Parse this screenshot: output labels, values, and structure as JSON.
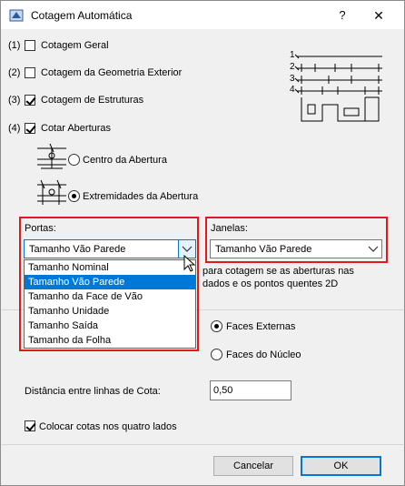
{
  "window": {
    "title": "Cotagem Automática",
    "help_label": "?",
    "close_label": "✕"
  },
  "options": [
    {
      "num": "(1)",
      "label": "Cotagem Geral",
      "checked": false
    },
    {
      "num": "(2)",
      "label": "Cotagem da Geometria Exterior",
      "checked": false
    },
    {
      "num": "(3)",
      "label": "Cotagem de Estruturas",
      "checked": true
    },
    {
      "num": "(4)",
      "label": "Cotar Aberturas",
      "checked": true
    }
  ],
  "diagram": {
    "levels": [
      "1",
      "2",
      "3",
      "4"
    ]
  },
  "opening_mode": [
    {
      "label": "Centro da Abertura",
      "selected": false
    },
    {
      "label": "Extremidades da Abertura",
      "selected": true
    }
  ],
  "portas": {
    "label": "Portas:",
    "value": "Tamanho Vão Parede",
    "options": [
      "Tamanho Nominal",
      "Tamanho Vão Parede",
      "Tamanho da Face de Vão",
      "Tamanho Unidade",
      "Tamanho Saída",
      "Tamanho da Folha"
    ],
    "selected_index": 1
  },
  "janelas": {
    "label": "Janelas:",
    "value": "Tamanho Vão Parede"
  },
  "hint": {
    "line1": "para cotagem se as aberturas nas",
    "line2": "dados e os pontos quentes 2D"
  },
  "faces": [
    {
      "label": "Faces Externas",
      "selected": true
    },
    {
      "label": "Faces do Núcleo",
      "selected": false
    }
  ],
  "distance": {
    "label": "Distância entre linhas de Cota:",
    "value": "0,50"
  },
  "four_sides": {
    "label": "Colocar cotas nos quatro lados",
    "checked": true
  },
  "buttons": {
    "cancel": "Cancelar",
    "ok": "OK"
  }
}
